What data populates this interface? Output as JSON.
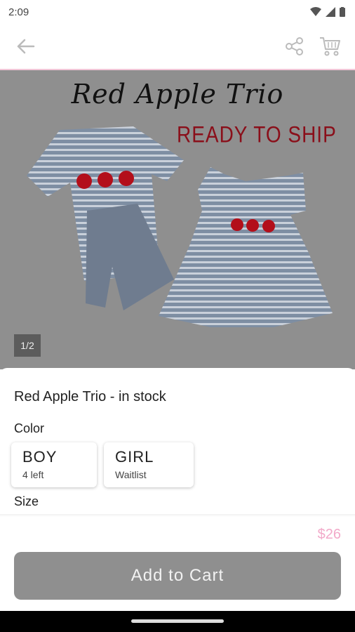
{
  "status_bar": {
    "time": "2:09"
  },
  "app_bar": {
    "back_icon": "arrow-left-icon",
    "share_icon": "share-icon",
    "cart_icon": "cart-icon"
  },
  "gallery": {
    "image_title": "Red Apple Trio",
    "image_subtitle": "READY TO SHIP",
    "page_indicator": "1/2",
    "background_color": "#8f8f8f"
  },
  "product": {
    "title": "Red Apple Trio - in stock",
    "color_label": "Color",
    "size_label": "Size",
    "options": [
      {
        "name": "BOY",
        "sub": "4 left"
      },
      {
        "name": "GIRL",
        "sub": "Waitlist"
      }
    ],
    "price": "$26",
    "price_color": "#f2a9c9"
  },
  "cta": {
    "label": "Add to Cart"
  }
}
